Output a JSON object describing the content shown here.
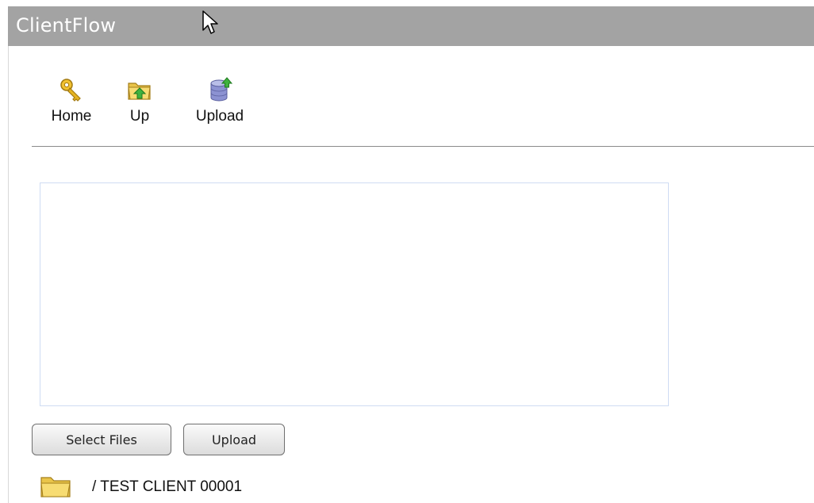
{
  "app": {
    "title": "ClientFlow"
  },
  "toolbar": {
    "items": [
      {
        "label": "Home",
        "icon": "key-icon"
      },
      {
        "label": "Up",
        "icon": "folder-up-icon"
      },
      {
        "label": "Upload",
        "icon": "database-upload-icon"
      }
    ]
  },
  "upload": {
    "select_files_label": "Select Files",
    "upload_label": "Upload"
  },
  "path": {
    "icon": "folder-icon",
    "text": "/ TEST CLIENT 00001"
  },
  "colors": {
    "titlebar": "#a3a3a3",
    "title_text": "#ffffff",
    "drop_area_border": "#cfdcf3",
    "folder": "#f3d35a",
    "key": "#e6b422",
    "arrow": "#3fb23f"
  }
}
